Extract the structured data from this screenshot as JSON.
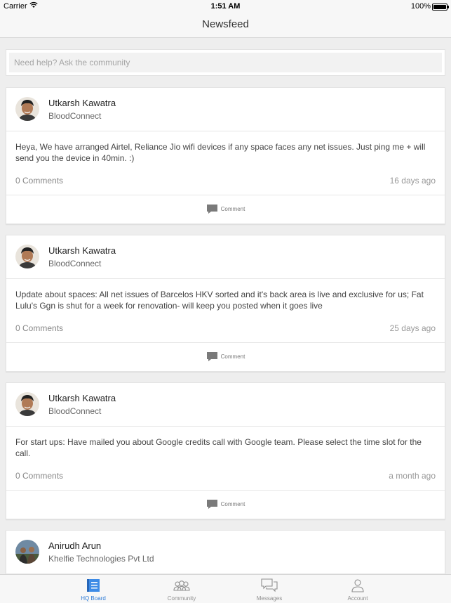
{
  "status_bar": {
    "carrier": "Carrier",
    "time": "1:51 AM",
    "battery": "100%"
  },
  "nav": {
    "title": "Newsfeed"
  },
  "search": {
    "placeholder": "Need help? Ask the community"
  },
  "posts": [
    {
      "author": "Utkarsh Kawatra",
      "org": "BloodConnect",
      "text": "Heya, We have arranged Airtel, Reliance Jio wifi devices if any space faces any net issues. Just ping me + will send you the device in 40min. :)",
      "comments": "0 Comments",
      "time_ago": "16 days ago",
      "action": "Comment"
    },
    {
      "author": "Utkarsh Kawatra",
      "org": "BloodConnect",
      "text": "Update about spaces: All net issues of Barcelos HKV sorted and it's back area is live and exclusive for us; Fat Lulu's Ggn is shut for a week for renovation- will keep you posted when it goes live",
      "comments": "0 Comments",
      "time_ago": "25 days ago",
      "action": "Comment"
    },
    {
      "author": "Utkarsh Kawatra",
      "org": "BloodConnect",
      "text": "For start ups: Have mailed you about Google credits call with Google team. Please select the time slot for the call.",
      "comments": "0 Comments",
      "time_ago": "a month ago",
      "action": "Comment"
    },
    {
      "author": "Anirudh Arun",
      "org": "Khelfie Technologies Pvt Ltd"
    }
  ],
  "tabs": [
    {
      "label": "HQ Board",
      "icon": "board-icon",
      "active": true
    },
    {
      "label": "Community",
      "icon": "community-icon",
      "active": false
    },
    {
      "label": "Messages",
      "icon": "messages-icon",
      "active": false
    },
    {
      "label": "Account",
      "icon": "account-icon",
      "active": false
    }
  ],
  "colors": {
    "accent": "#2e7bd6",
    "background": "#eeeeee",
    "card": "#ffffff"
  }
}
